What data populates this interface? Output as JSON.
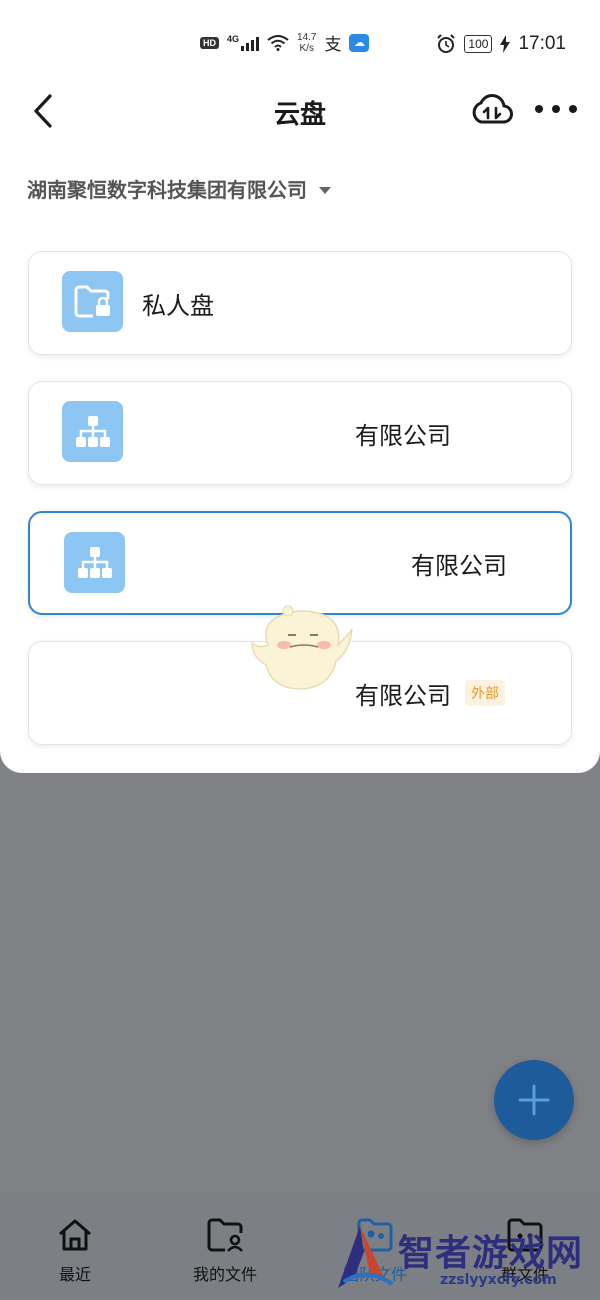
{
  "status_bar": {
    "hd": "HD",
    "network": "4G",
    "speed_value": "14.7",
    "speed_unit": "K/s",
    "battery": "100",
    "time": "17:01"
  },
  "header": {
    "title": "云盘"
  },
  "org_selector": {
    "name": "湖南聚恒数字科技集团有限公司"
  },
  "cards": [
    {
      "label": "私人盘",
      "icon": "private-folder-lock-icon",
      "selected": false
    },
    {
      "label": "有限公司",
      "icon": "org-chart-icon",
      "selected": false
    },
    {
      "label": "有限公司",
      "icon": "org-chart-icon",
      "selected": true
    },
    {
      "label": "有限公司",
      "badge": "外部",
      "selected": false
    }
  ],
  "fab": {
    "icon": "plus-icon"
  },
  "bottom_nav": [
    {
      "label": "最近",
      "icon": "home-icon"
    },
    {
      "label": "我的文件",
      "icon": "user-folder-icon"
    },
    {
      "label": "团队文件",
      "icon": "team-folder-icon"
    },
    {
      "label": "群文件",
      "icon": "group-folder-icon"
    }
  ],
  "watermark": {
    "text": "智者游戏网",
    "sub": "zzslyyxcfy.com"
  },
  "colors": {
    "accent": "#2f86d6",
    "icon_bg": "#8ec6f3",
    "fab": "#1d5b9a",
    "badge_text": "#e69a2a",
    "overlay": "#7f8185"
  }
}
